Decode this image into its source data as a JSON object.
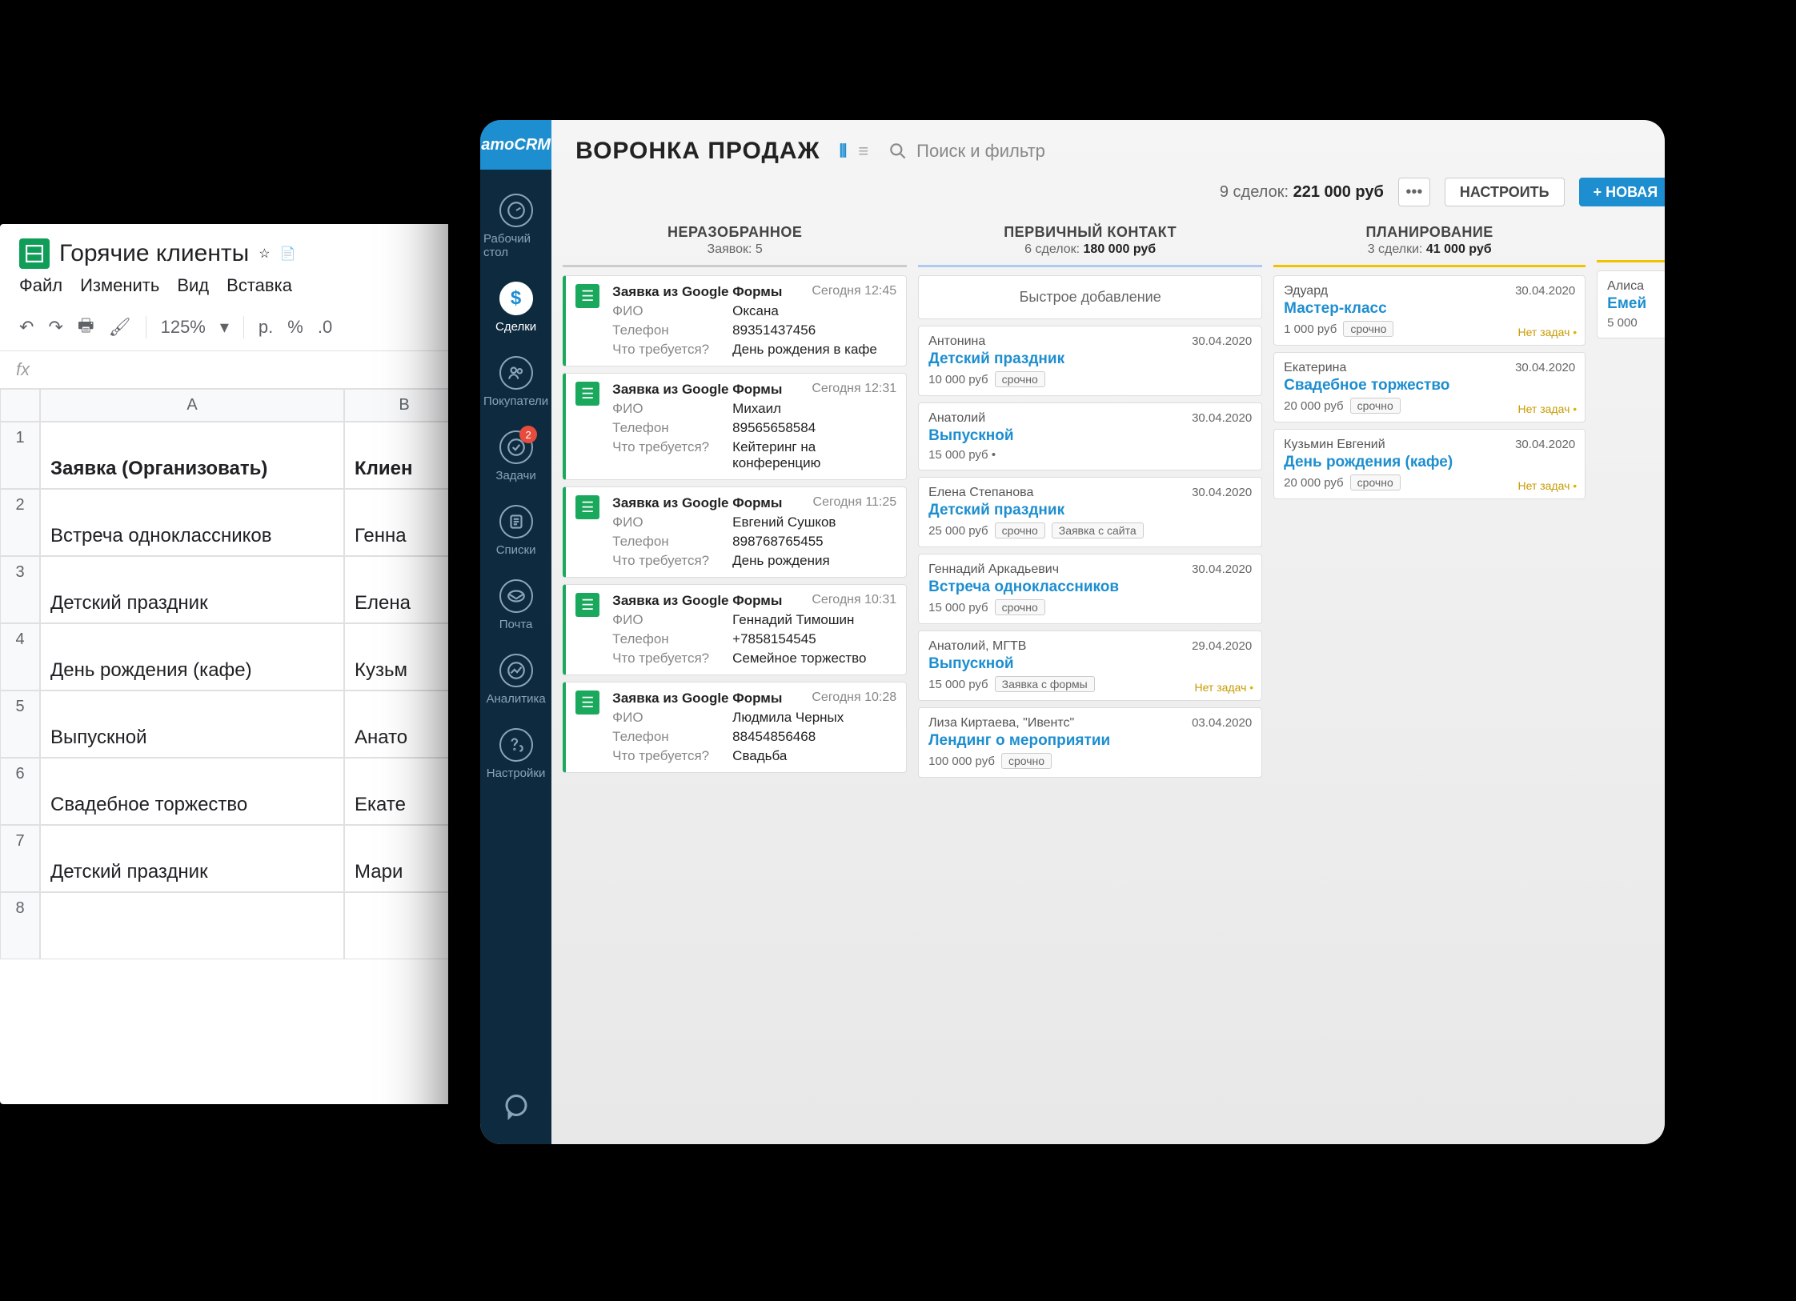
{
  "sheets": {
    "title": "Горячие клиенты",
    "menu": [
      "Файл",
      "Изменить",
      "Вид",
      "Вставка"
    ],
    "zoom": "125%",
    "currency": "р.",
    "percent": "%",
    "decimal": ".0",
    "fx_label": "fx",
    "columns": [
      "A",
      "B"
    ],
    "header_row": {
      "a": "Заявка (Организовать)",
      "b": "Клиен"
    },
    "rows": [
      {
        "a": "Встреча одноклассников",
        "b": "Генна"
      },
      {
        "a": "Детский праздник",
        "b": "Елена"
      },
      {
        "a": "День рождения (кафе)",
        "b": "Кузьм"
      },
      {
        "a": "Выпускной",
        "b": "Анато"
      },
      {
        "a": "Свадебное торжество",
        "b": "Екате"
      },
      {
        "a": "Детский праздник",
        "b": "Мари"
      }
    ]
  },
  "crm": {
    "logo": "amoCRM",
    "nav": [
      {
        "label": "Рабочий стол",
        "badge": null
      },
      {
        "label": "Сделки",
        "badge": null,
        "active": true
      },
      {
        "label": "Покупатели",
        "badge": null
      },
      {
        "label": "Задачи",
        "badge": "2"
      },
      {
        "label": "Списки",
        "badge": null
      },
      {
        "label": "Почта",
        "badge": null
      },
      {
        "label": "Аналитика",
        "badge": null
      },
      {
        "label": "Настройки",
        "badge": null
      }
    ],
    "title": "ВОРОНКА ПРОДАЖ",
    "search_placeholder": "Поиск и фильтр",
    "summary": {
      "deals": "9 сделок:",
      "amount": "221 000 руб"
    },
    "btn_settings": "НАСТРОИТЬ",
    "btn_new": "+ НОВАЯ",
    "columns": {
      "unsorted": {
        "title": "НЕРАЗОБРАННОЕ",
        "sub": "Заявок: 5",
        "leads": [
          {
            "title": "Заявка из Google Формы",
            "time": "Сегодня 12:45",
            "fio_l": "ФИО",
            "fio": "Оксана",
            "tel_l": "Телефон",
            "tel": "89351437456",
            "req_l": "Что требуется?",
            "req": "День рождения в кафе"
          },
          {
            "title": "Заявка из Google Формы",
            "time": "Сегодня 12:31",
            "fio_l": "ФИО",
            "fio": "Михаил",
            "tel_l": "Телефон",
            "tel": "89565658584",
            "req_l": "Что требуется?",
            "req": "Кейтеринг на конференцию"
          },
          {
            "title": "Заявка из Google Формы",
            "time": "Сегодня 11:25",
            "fio_l": "ФИО",
            "fio": "Евгений Сушков",
            "tel_l": "Телефон",
            "tel": "898768765455",
            "req_l": "Что требуется?",
            "req": "День рождения"
          },
          {
            "title": "Заявка из Google Формы",
            "time": "Сегодня 10:31",
            "fio_l": "ФИО",
            "fio": "Геннадий Тимошин",
            "tel_l": "Телефон",
            "tel": "+7858154545",
            "req_l": "Что требуется?",
            "req": "Семейное торжество"
          },
          {
            "title": "Заявка из Google Формы",
            "time": "Сегодня 10:28",
            "fio_l": "ФИО",
            "fio": "Людмила Черных",
            "tel_l": "Телефон",
            "tel": "88454856468",
            "req_l": "Что требуется?",
            "req": "Свадьба"
          }
        ]
      },
      "primary": {
        "title": "ПЕРВИЧНЫЙ КОНТАКТ",
        "sub_deals": "6 сделок:",
        "sub_amount": "180 000 руб",
        "quick_add": "Быстрое добавление",
        "deals": [
          {
            "contact": "Антонина",
            "name": "Детский праздник",
            "price": "10 000 руб",
            "tags": [
              "срочно"
            ],
            "date": "30.04.2020",
            "warn": ""
          },
          {
            "contact": "Анатолий",
            "name": "Выпускной",
            "price": "15 000 руб •",
            "tags": [],
            "date": "30.04.2020",
            "warn": ""
          },
          {
            "contact": "Елена Степанова",
            "name": "Детский праздник",
            "price": "25 000 руб",
            "tags": [
              "срочно",
              "Заявка с сайта"
            ],
            "date": "30.04.2020",
            "warn": ""
          },
          {
            "contact": "Геннадий Аркадьевич",
            "name": "Встреча одноклассников",
            "price": "15 000 руб",
            "tags": [
              "срочно"
            ],
            "date": "30.04.2020",
            "warn": ""
          },
          {
            "contact": "Анатолий, МГТВ",
            "name": "Выпускной",
            "price": "15 000 руб",
            "tags": [
              "Заявка с формы"
            ],
            "date": "29.04.2020",
            "warn": "Нет задач"
          },
          {
            "contact": "Лиза Киртаева, \"Ивентс\"",
            "name": "Лендинг о мероприятии",
            "price": "100 000 руб",
            "tags": [
              "срочно"
            ],
            "date": "03.04.2020",
            "warn": ""
          }
        ]
      },
      "planning": {
        "title": "ПЛАНИРОВАНИЕ",
        "sub_deals": "3 сделки:",
        "sub_amount": "41 000 руб",
        "deals": [
          {
            "contact": "Эдуард",
            "name": "Мастер-класс",
            "price": "1 000 руб",
            "tags": [
              "срочно"
            ],
            "date": "30.04.2020",
            "warn": "Нет задач"
          },
          {
            "contact": "Екатерина",
            "name": "Свадебное торжество",
            "price": "20 000 руб",
            "tags": [
              "срочно"
            ],
            "date": "30.04.2020",
            "warn": "Нет задач"
          },
          {
            "contact": "Кузьмин Евгений",
            "name": "День рождения (кафе)",
            "price": "20 000 руб",
            "tags": [
              "срочно"
            ],
            "date": "30.04.2020",
            "warn": "Нет задач"
          }
        ]
      },
      "extra": {
        "deals": [
          {
            "contact": "Алиса",
            "name": "Емей",
            "price": "5 000"
          }
        ]
      }
    }
  }
}
